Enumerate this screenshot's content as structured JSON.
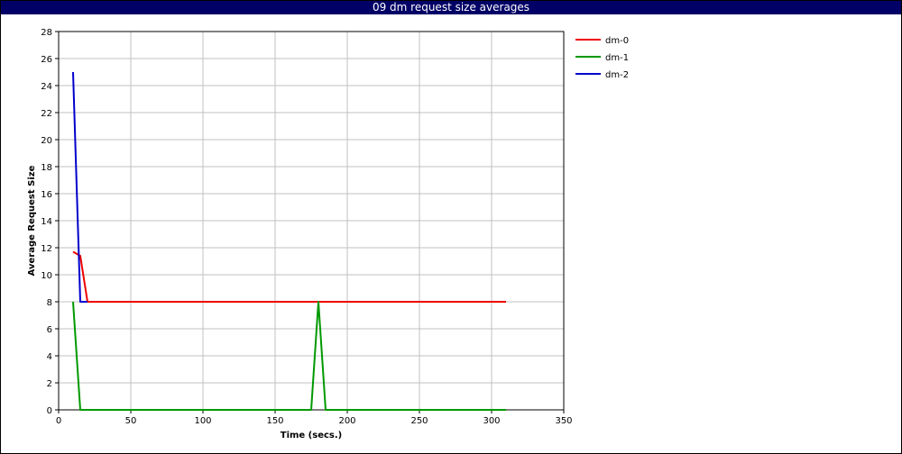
{
  "chart_data": {
    "type": "line",
    "title": "09 dm request size averages",
    "xlabel": "Time (secs.)",
    "ylabel": "Average Request Size",
    "xlim": [
      0,
      350
    ],
    "ylim": [
      0,
      28
    ],
    "xticks": [
      0,
      50,
      100,
      150,
      200,
      250,
      300,
      350
    ],
    "yticks": [
      0,
      2,
      4,
      6,
      8,
      10,
      12,
      14,
      16,
      18,
      20,
      22,
      24,
      26,
      28
    ],
    "grid": true,
    "legend_position": "top-right, outside plot",
    "series": [
      {
        "name": "dm-0",
        "color": "#ee0000",
        "points": [
          [
            10,
            11.7
          ],
          [
            15,
            11.4
          ],
          [
            20,
            8
          ],
          [
            50,
            8
          ],
          [
            100,
            8
          ],
          [
            150,
            8
          ],
          [
            200,
            8
          ],
          [
            250,
            8
          ],
          [
            300,
            8
          ],
          [
            310,
            8
          ]
        ]
      },
      {
        "name": "dm-1",
        "color": "#009900",
        "points": [
          [
            10,
            8
          ],
          [
            15,
            0
          ],
          [
            50,
            0
          ],
          [
            100,
            0
          ],
          [
            150,
            0
          ],
          [
            175,
            0
          ],
          [
            180,
            8
          ],
          [
            185,
            0
          ],
          [
            250,
            0
          ],
          [
            310,
            0
          ]
        ]
      },
      {
        "name": "dm-2",
        "color": "#0000cc",
        "points": [
          [
            10,
            25
          ],
          [
            15,
            8
          ],
          [
            20,
            8
          ]
        ]
      }
    ]
  }
}
